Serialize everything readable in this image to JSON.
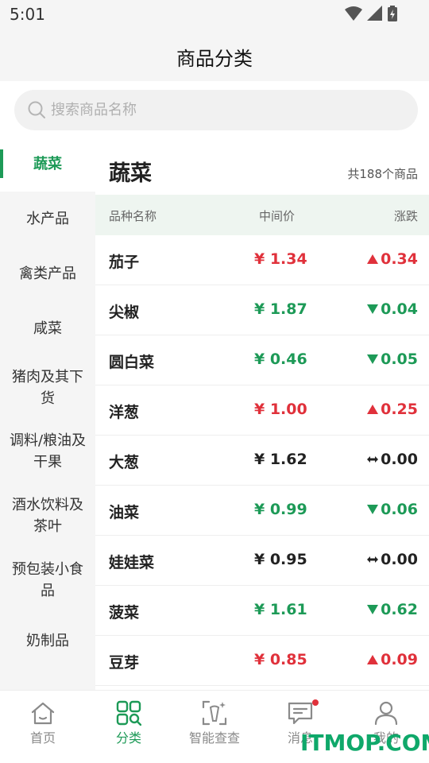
{
  "status": {
    "time": "5:01"
  },
  "header": {
    "title": "商品分类"
  },
  "search": {
    "placeholder": "搜索商品名称",
    "value": ""
  },
  "sidebar": {
    "items": [
      {
        "label": "蔬菜"
      },
      {
        "label": "水产品"
      },
      {
        "label": "禽类产品"
      },
      {
        "label": "咸菜"
      },
      {
        "label": "猪肉及其下货"
      },
      {
        "label": "调料/粮油及干果"
      },
      {
        "label": "酒水饮料及茶叶"
      },
      {
        "label": "预包装小食品"
      },
      {
        "label": "奶制品"
      }
    ],
    "active_index": 0
  },
  "main": {
    "category_title": "蔬菜",
    "count_text": "共188个商品",
    "columns": {
      "name": "品种名称",
      "price": "中间价",
      "change": "涨跌"
    },
    "rows": [
      {
        "name": "茄子",
        "price": "¥ 1.34",
        "change": "0.34",
        "trend": "up"
      },
      {
        "name": "尖椒",
        "price": "¥ 1.87",
        "change": "0.04",
        "trend": "down"
      },
      {
        "name": "圆白菜",
        "price": "¥ 0.46",
        "change": "0.05",
        "trend": "down"
      },
      {
        "name": "洋葱",
        "price": "¥ 1.00",
        "change": "0.25",
        "trend": "up"
      },
      {
        "name": "大葱",
        "price": "¥ 1.62",
        "change": "0.00",
        "trend": "flat"
      },
      {
        "name": "油菜",
        "price": "¥ 0.99",
        "change": "0.06",
        "trend": "down"
      },
      {
        "name": "娃娃菜",
        "price": "¥ 0.95",
        "change": "0.00",
        "trend": "flat"
      },
      {
        "name": "菠菜",
        "price": "¥ 1.61",
        "change": "0.62",
        "trend": "down"
      },
      {
        "name": "豆芽",
        "price": "¥ 0.85",
        "change": "0.09",
        "trend": "up"
      }
    ]
  },
  "tabs": [
    {
      "label": "首页",
      "icon": "home-icon"
    },
    {
      "label": "分类",
      "icon": "category-icon"
    },
    {
      "label": "智能查查",
      "icon": "smart-scan-icon"
    },
    {
      "label": "消息",
      "icon": "message-icon"
    },
    {
      "label": "我的",
      "icon": "profile-icon"
    }
  ],
  "active_tab": 1,
  "colors": {
    "accent": "#1d9a57",
    "up": "#e0313b",
    "down": "#1d9a57"
  },
  "watermark": "ITMOP.COM"
}
